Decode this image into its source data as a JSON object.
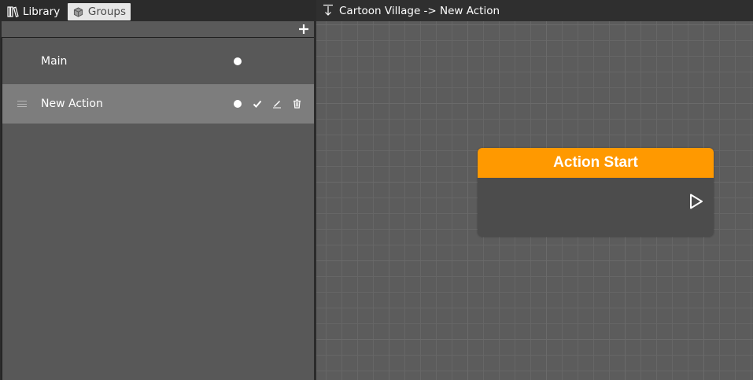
{
  "tabs": {
    "library_label": "Library",
    "groups_label": "Groups",
    "library_icon": "library-books-icon",
    "groups_icon": "cube-icon"
  },
  "groups_panel": {
    "add_icon": "plus-icon",
    "rows": [
      {
        "label": "Main",
        "selected": false,
        "icons": [
          "dot-icon"
        ]
      },
      {
        "label": "New Action",
        "selected": true,
        "icons": [
          "drag-handle-icon",
          "dot-icon",
          "check-icon",
          "pencil-icon",
          "trash-icon"
        ]
      }
    ]
  },
  "graph": {
    "breadcrumb": "Cartoon Village -> New Action",
    "back_icon": "arrow-down-icon",
    "node": {
      "title": "Action Start",
      "header_color": "#ff9900",
      "output_icon": "play-outline-icon"
    }
  },
  "colors": {
    "selected_row": "#7d7d7d",
    "canvas": "#5c5c5c",
    "accent": "#ff9900"
  }
}
